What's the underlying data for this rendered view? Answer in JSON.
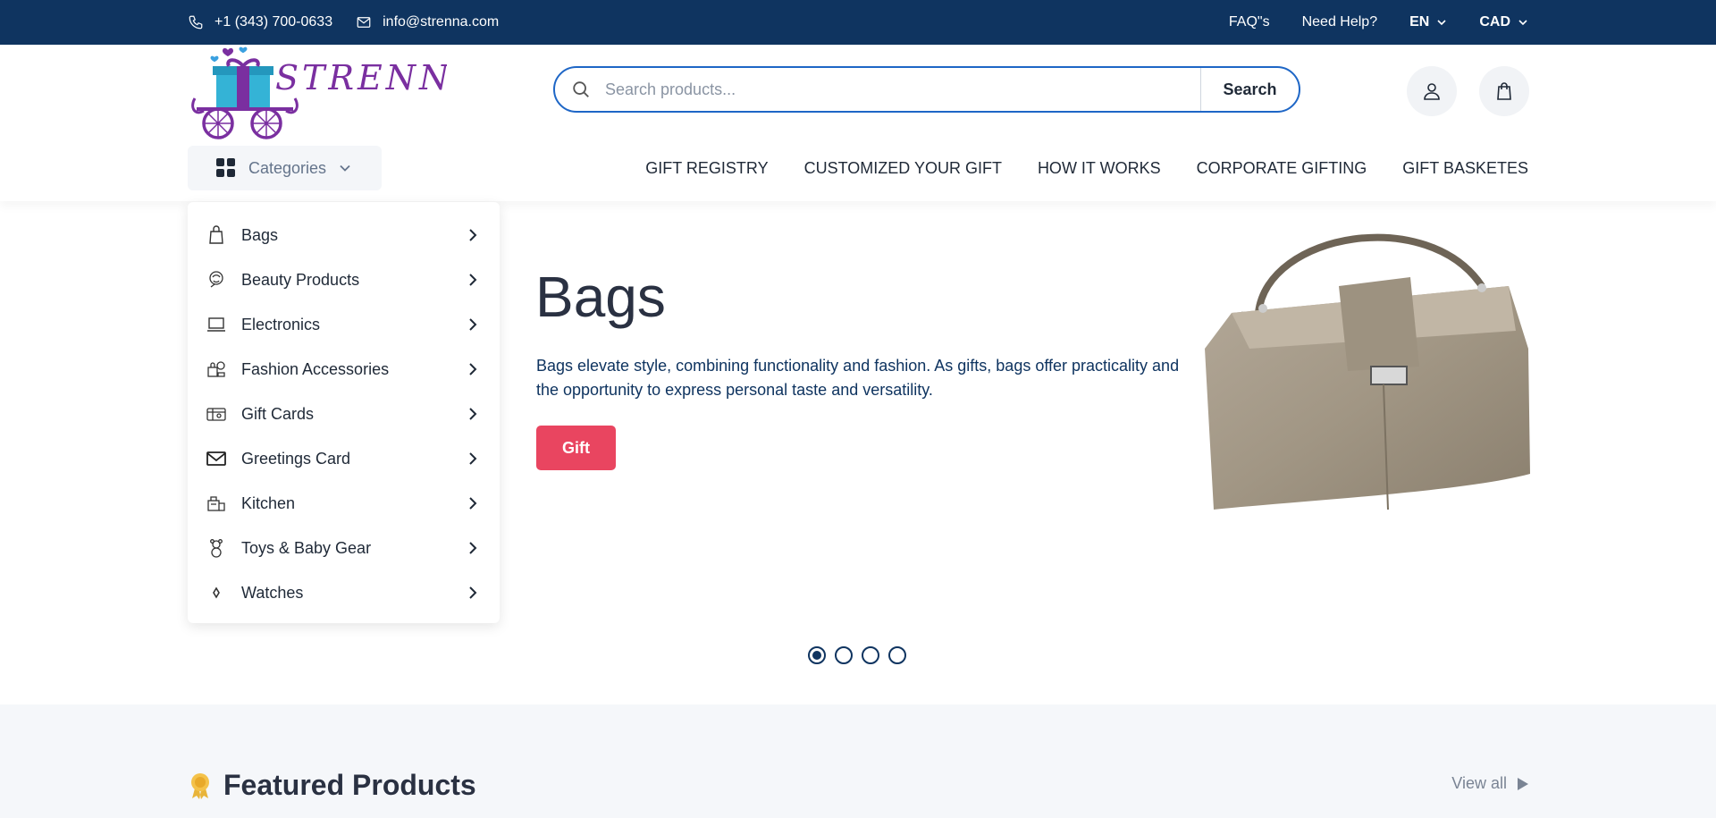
{
  "topbar": {
    "phone": "+1 (343) 700-0633",
    "email": "info@strenna.com",
    "faq": "FAQ\"s",
    "help": "Need Help?",
    "language": "EN",
    "currency": "CAD"
  },
  "header": {
    "logo_text": "STRENNA",
    "search_placeholder": "Search products...",
    "search_button": "Search",
    "categories_label": "Categories"
  },
  "nav": [
    {
      "label": "GIFT REGISTRY"
    },
    {
      "label": "CUSTOMIZED YOUR GIFT"
    },
    {
      "label": "HOW IT WORKS"
    },
    {
      "label": "CORPORATE GIFTING"
    },
    {
      "label": "GIFT BASKETES"
    }
  ],
  "categories": [
    {
      "label": "Bags",
      "icon": "bag-icon"
    },
    {
      "label": "Beauty Products",
      "icon": "beauty-icon"
    },
    {
      "label": "Electronics",
      "icon": "laptop-icon"
    },
    {
      "label": "Fashion Accessories",
      "icon": "fashion-icon"
    },
    {
      "label": "Gift Cards",
      "icon": "gift-card-icon"
    },
    {
      "label": "Greetings Card",
      "icon": "envelope-icon"
    },
    {
      "label": "Kitchen",
      "icon": "kitchen-icon"
    },
    {
      "label": "Toys & Baby Gear",
      "icon": "teddy-bear-icon"
    },
    {
      "label": "Watches",
      "icon": "watch-icon"
    }
  ],
  "hero": {
    "title": "Bags",
    "description": "Bags elevate style, combining functionality and fashion. As gifts, bags offer practicality and the opportunity to express personal taste and versatility.",
    "button": "Gift",
    "slide_count": 4,
    "active_slide": 1
  },
  "featured": {
    "title": "Featured Products",
    "view_all": "View all"
  },
  "colors": {
    "topbar_bg": "#0f3460",
    "accent": "#e94560",
    "search_border": "#1e66c6"
  }
}
